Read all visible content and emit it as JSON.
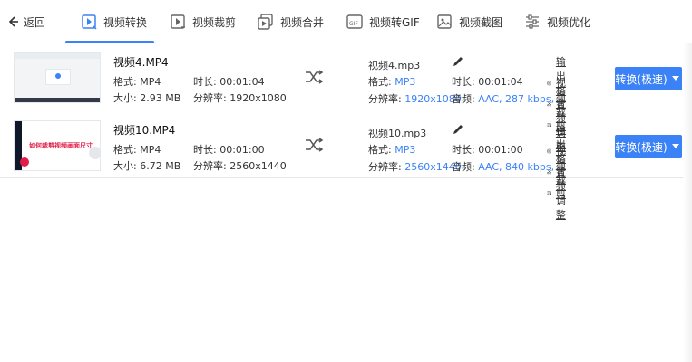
{
  "nav": {
    "back_label": "返回",
    "tabs": [
      {
        "label": "视频转换",
        "icon": "play-icon",
        "active": true
      },
      {
        "label": "视频裁剪",
        "icon": "crop-play-icon"
      },
      {
        "label": "视频合并",
        "icon": "merge-play-icon"
      },
      {
        "label": "视频转GIF",
        "icon": "gif-icon"
      },
      {
        "label": "视频截图",
        "icon": "screenshot-icon"
      },
      {
        "label": "视频优化",
        "icon": "sliders-icon"
      }
    ]
  },
  "rows": [
    {
      "source": {
        "name": "视频4.MP4",
        "format_label": "格式:",
        "format": "MP4",
        "duration_label": "时长:",
        "duration": "00:01:04",
        "size_label": "大小:",
        "size": "2.93 MB",
        "resolution_label": "分辨率:",
        "resolution": "1920x1080"
      },
      "output": {
        "name": "视频4.mp3",
        "format_label": "格式:",
        "format": "MP3",
        "duration_label": "时长:",
        "duration": "00:01:04",
        "resolution_label": "分辨率:",
        "resolution": "1920x1080",
        "audio_label": "音频:",
        "audio": "AAC, 287 kbps, ..."
      },
      "actions": [
        "输出格式",
        "视频裁剪",
        "音频调整"
      ],
      "convert_label": "转换(极速)"
    },
    {
      "source": {
        "name": "视频10.MP4",
        "format_label": "格式:",
        "format": "MP4",
        "duration_label": "时长:",
        "duration": "00:01:00",
        "size_label": "大小:",
        "size": "6.72 MB",
        "resolution_label": "分辨率:",
        "resolution": "2560x1440"
      },
      "output": {
        "name": "视频10.mp3",
        "format_label": "格式:",
        "format": "MP3",
        "duration_label": "时长:",
        "duration": "00:01:00",
        "resolution_label": "分辨率:",
        "resolution": "2560x1440",
        "audio_label": "音频:",
        "audio": "AAC, 840 kbps, ..."
      },
      "actions": [
        "输出格式",
        "视频裁剪",
        "音频调整"
      ],
      "convert_label": "转换(极速)",
      "thumb_text": "如何裁剪视频画面尺寸"
    }
  ],
  "colors": {
    "accent": "#3b82f6",
    "text": "#333333",
    "divider": "#e6e6e6"
  }
}
